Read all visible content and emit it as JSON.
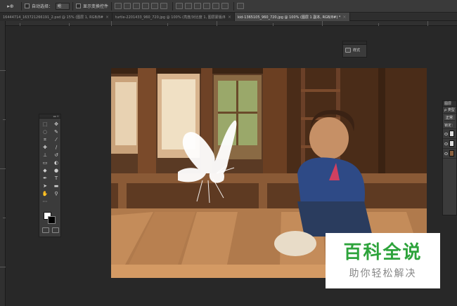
{
  "options_bar": {
    "tool_label": "▸⊕",
    "auto_select_label": "自动选择：",
    "auto_select_value": "组",
    "show_transform_label": "显示变换控件"
  },
  "tabs": [
    {
      "label": "16444714_163721266191_2.psd @ 15% (图层 1, RGB/8#)",
      "active": false
    },
    {
      "label": "turtle-2201433_960_720.jpg @ 100% (亮度/对比度 1, 图层蒙版/8)",
      "active": false
    },
    {
      "label": "kid-1365105_960_720.jpg @ 100% (图层 1 副本, RGB/8#) *",
      "active": true
    }
  ],
  "mini_panel": {
    "label": "样式"
  },
  "layers_panel": {
    "title": "图层",
    "kind_label": "ρ 类型",
    "blend_mode": "正常",
    "lock_label": "锁定："
  },
  "colors": {
    "foreground": "#ffffff",
    "background": "#000000",
    "watermark_green": "#2da33b"
  },
  "watermark": {
    "title": "百科全说",
    "subtitle": "助你轻松解决"
  }
}
